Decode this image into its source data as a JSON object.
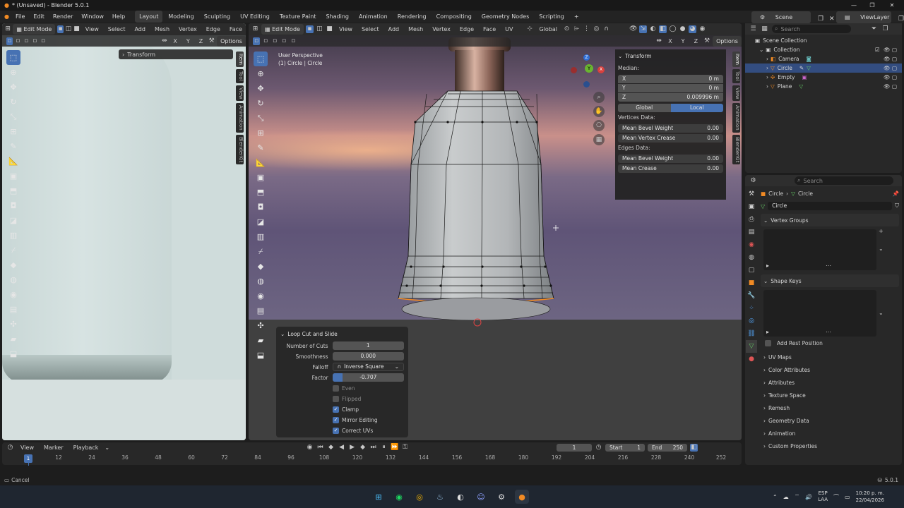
{
  "window": {
    "title": "* (Unsaved) - Blender 5.0.1",
    "controls": [
      "—",
      "❐",
      "✕"
    ]
  },
  "menu": [
    "File",
    "Edit",
    "Render",
    "Window",
    "Help"
  ],
  "workspaces": [
    "Layout",
    "Modeling",
    "Sculpting",
    "UV Editing",
    "Texture Paint",
    "Shading",
    "Animation",
    "Rendering",
    "Compositing",
    "Geometry Nodes",
    "Scripting"
  ],
  "workspace_add": "+",
  "scene": {
    "name": "Scene",
    "view_layer": "ViewLayer"
  },
  "left_editor": {
    "mode": "Edit Mode",
    "menus": [
      "View",
      "Select",
      "Add",
      "Mesh",
      "Vertex",
      "Edge",
      "Face"
    ],
    "axes": [
      "X",
      "Y",
      "Z"
    ],
    "options": "Options",
    "transform_panel": "Transform",
    "side_tabs": [
      "Item",
      "Tool",
      "View",
      "Animation",
      "BlenderKit"
    ]
  },
  "viewport": {
    "mode": "Edit Mode",
    "menus": [
      "View",
      "Select",
      "Add",
      "Mesh",
      "Vertex",
      "Edge",
      "Face",
      "UV"
    ],
    "orientation": "Global",
    "axes": [
      "X",
      "Y",
      "Z"
    ],
    "options": "Options",
    "info_line1": "User Perspective",
    "info_line2": "(1) Circle | Circle",
    "gizmo": {
      "x": "X",
      "y": "Y",
      "z": "Z"
    },
    "side_tabs": [
      "Item",
      "Tool",
      "View",
      "Animation",
      "BlenderKit"
    ]
  },
  "npanel": {
    "title": "Transform",
    "median_label": "Median:",
    "x_label": "X",
    "x_value": "0 m",
    "y_label": "Y",
    "y_value": "0 m",
    "z_label": "Z",
    "z_value": "0.009996 m",
    "global": "Global",
    "local": "Local",
    "vertices_data": "Vertices Data:",
    "mean_bevel_weight_v": "Mean Bevel Weight",
    "mean_bevel_weight_v_value": "0.00",
    "mean_vertex_crease": "Mean Vertex Crease",
    "mean_vertex_crease_value": "0.00",
    "edges_data": "Edges Data:",
    "mean_bevel_weight_e": "Mean Bevel Weight",
    "mean_bevel_weight_e_value": "0.00",
    "mean_crease": "Mean Crease",
    "mean_crease_value": "0.00"
  },
  "operator": {
    "title": "Loop Cut and Slide",
    "number_of_cuts_label": "Number of Cuts",
    "number_of_cuts": "1",
    "smoothness_label": "Smoothness",
    "smoothness": "0.000",
    "falloff_label": "Falloff",
    "falloff": "Inverse Square",
    "factor_label": "Factor",
    "factor": "-0.707",
    "factor_fraction": 0.146,
    "even": "Even",
    "even_checked": false,
    "flipped": "Flipped",
    "flipped_checked": false,
    "clamp": "Clamp",
    "clamp_checked": true,
    "mirror_editing": "Mirror Editing",
    "mirror_checked": true,
    "correct_uvs": "Correct UVs",
    "correct_uvs_checked": true
  },
  "outliner": {
    "search_placeholder": "Search",
    "root": "Scene Collection",
    "collection": "Collection",
    "items": [
      "Camera",
      "Circle",
      "Empty",
      "Plane"
    ],
    "selected": "Circle"
  },
  "properties": {
    "search_placeholder": "Search",
    "breadcrumb_object": "Circle",
    "breadcrumb_data": "Circle",
    "mesh_name": "Circle",
    "vertex_groups": "Vertex Groups",
    "shape_keys": "Shape Keys",
    "add_rest_position": "Add Rest Position",
    "sections": [
      "UV Maps",
      "Color Attributes",
      "Attributes",
      "Texture Space",
      "Remesh",
      "Geometry Data",
      "Animation",
      "Custom Properties"
    ]
  },
  "timeline": {
    "menus": [
      "View",
      "Marker",
      "Playback"
    ],
    "current_frame": "1",
    "start_label": "Start",
    "start": "1",
    "end_label": "End",
    "end": "250",
    "ticks": [
      "1",
      "12",
      "24",
      "36",
      "48",
      "60",
      "72",
      "84",
      "96",
      "108",
      "120",
      "132",
      "144",
      "156",
      "168",
      "180",
      "192",
      "204",
      "216",
      "228",
      "240",
      "252"
    ]
  },
  "statusbar": {
    "left": "Cancel",
    "version": "5.0.1"
  },
  "taskbar": {
    "lang1": "ESP",
    "lang2": "LAA",
    "time": "10:20 p. m.",
    "date": "22/04/2026"
  },
  "colors": {
    "accent": "#4772b3",
    "selected_edge": "#f08a24",
    "bg": "#1d1d1d"
  }
}
